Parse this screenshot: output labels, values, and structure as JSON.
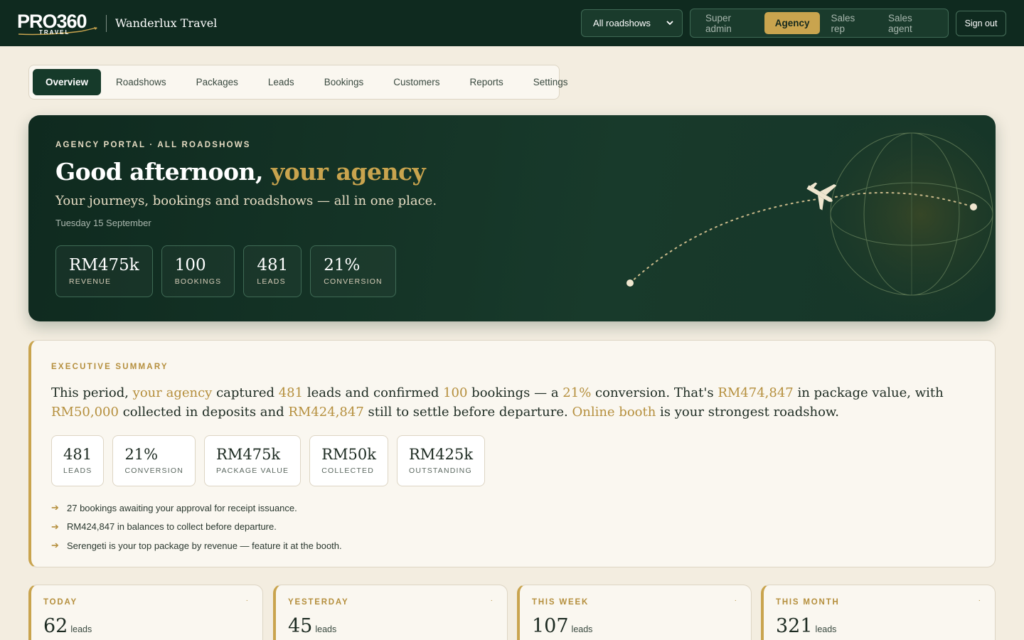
{
  "header": {
    "logo_text": "PRO360",
    "logo_sub": "TRAVEL",
    "brand_name": "Wanderlux Travel",
    "roadshow_select": {
      "value": "All roadshows"
    },
    "roles": [
      "Super admin",
      "Agency",
      "Sales rep",
      "Sales agent"
    ],
    "active_role": "Agency",
    "sign_out": "Sign out"
  },
  "nav": {
    "tabs": [
      "Overview",
      "Roadshows",
      "Packages",
      "Leads",
      "Bookings",
      "Customers",
      "Reports",
      "Settings"
    ],
    "active": "Overview"
  },
  "hero": {
    "eyebrow": "AGENCY PORTAL · ALL ROADSHOWS",
    "greeting": "Good afternoon,",
    "greeting_highlight": "your agency",
    "subtitle": "Your journeys, bookings and roadshows — all in one place.",
    "date": "Tuesday 15 September",
    "stats": [
      {
        "value": "RM475k",
        "label": "REVENUE"
      },
      {
        "value": "100",
        "label": "BOOKINGS"
      },
      {
        "value": "481",
        "label": "LEADS"
      },
      {
        "value": "21%",
        "label": "CONVERSION"
      }
    ]
  },
  "summary": {
    "eyebrow": "EXECUTIVE SUMMARY",
    "text": {
      "p1": "This period, ",
      "h1": "your agency",
      "p2": " captured ",
      "h2": "481",
      "p3": " leads and confirmed ",
      "h3": "100",
      "p4": " bookings — a ",
      "h4": "21%",
      "p5": " conversion. That's ",
      "h5": "RM474,847",
      "p6": " in package value, with ",
      "h6": "RM50,000",
      "p7": " collected in deposits and ",
      "h7": "RM424,847",
      "p8": " still to settle before departure. ",
      "h8": "Online booth",
      "p9": " is your strongest roadshow."
    },
    "stats": [
      {
        "value": "481",
        "label": "LEADS"
      },
      {
        "value": "21%",
        "label": "CONVERSION"
      },
      {
        "value": "RM475k",
        "label": "PACKAGE VALUE"
      },
      {
        "value": "RM50k",
        "label": "COLLECTED"
      },
      {
        "value": "RM425k",
        "label": "OUTSTANDING"
      }
    ],
    "bullets": [
      "27 bookings awaiting your approval for receipt issuance.",
      "RM424,847 in balances to collect before departure.",
      "Serengeti is your top package by revenue — feature it at the booth."
    ]
  },
  "periods": [
    {
      "label": "TODAY",
      "value": "62",
      "unit": "leads"
    },
    {
      "label": "YESTERDAY",
      "value": "45",
      "unit": "leads"
    },
    {
      "label": "THIS WEEK",
      "value": "107",
      "unit": "leads"
    },
    {
      "label": "THIS MONTH",
      "value": "321",
      "unit": "leads"
    }
  ],
  "colors": {
    "primary": "#0f2a1f",
    "accent": "#c9a44e",
    "background": "#f3ede0"
  }
}
